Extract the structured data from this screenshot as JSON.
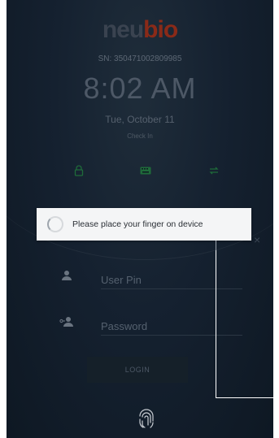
{
  "brand": {
    "neu": "neu",
    "bio": "bio"
  },
  "device": {
    "serial": "SN: 350471002809985"
  },
  "clock": {
    "time": "8:02 AM",
    "date": "Tue, October 11",
    "status": "Check In"
  },
  "mode_icons": [
    "lock-icon",
    "keyboard-icon",
    "switch-icon"
  ],
  "popup": {
    "message": "Please place your finger on device"
  },
  "close_label": "×",
  "form": {
    "user_pin_placeholder": "User Pin",
    "password_placeholder": "Password",
    "login_label": "LOGIN"
  },
  "colors": {
    "background": "#152130",
    "brand_orange": "#8a2a18",
    "accent_green": "#1f6b3a",
    "popup_bg": "#f4f5f6"
  }
}
